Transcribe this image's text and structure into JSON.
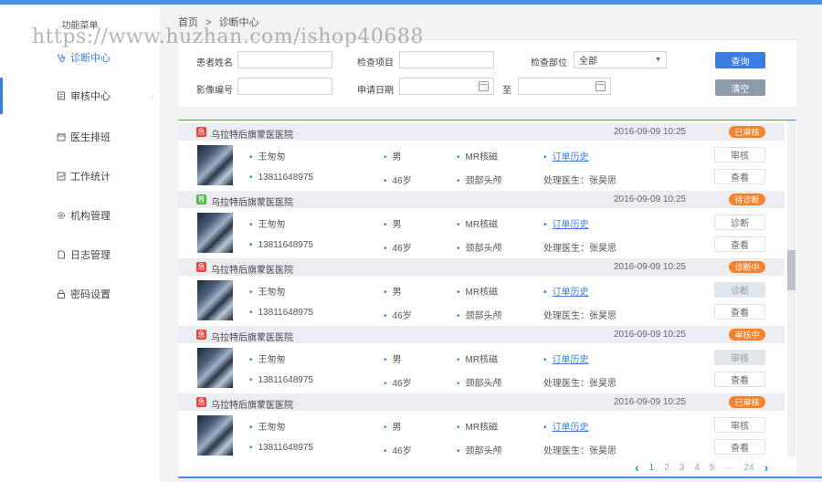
{
  "watermark": "https://www.huzhan.com/ishop40688",
  "breadcrumb": {
    "home": "首页",
    "separator": ">",
    "current": "诊断中心"
  },
  "sidebar": {
    "title": "功能菜单",
    "items": [
      {
        "label": "诊断中心",
        "icon": "stethoscope-icon"
      },
      {
        "label": "审核中心",
        "icon": "document-icon"
      },
      {
        "label": "医生排班",
        "icon": "calendar-icon"
      },
      {
        "label": "工作统计",
        "icon": "chart-icon"
      },
      {
        "label": "机构管理",
        "icon": "gear-icon"
      },
      {
        "label": "日志管理",
        "icon": "log-icon"
      },
      {
        "label": "密码设置",
        "icon": "lock-icon"
      }
    ],
    "chevron": "›"
  },
  "search": {
    "patient_name_label": "患者姓名",
    "exam_item_label": "检查项目",
    "exam_part_label": "检查部位",
    "exam_part_value": "全部",
    "dropdown_arrow": "▼",
    "image_no_label": "影像编号",
    "apply_date_label": "申请日期",
    "to_label": "至",
    "query_button": "查询",
    "clear_button": "清空"
  },
  "records": [
    {
      "hospital": "乌拉特后旗蒙医医院",
      "tag": "急",
      "tag_color": "#e8453c",
      "time": "2016-09-09  10:25",
      "status": "已审核",
      "name": "王匆匆",
      "phone": "13811648975",
      "gender": "男",
      "age": "46岁",
      "modality": "MR核磁",
      "part": "颈部头颅",
      "history": "订单历史",
      "doctor": "处理医生：张昊思",
      "action1": "审核",
      "action1_disabled": false,
      "action2": "查看"
    },
    {
      "hospital": "乌拉特后旗蒙医医院",
      "tag": "普",
      "tag_color": "#4cb848",
      "time": "2016-09-09  10:25",
      "status": "待诊断",
      "name": "王匆匆",
      "phone": "13811648975",
      "gender": "男",
      "age": "46岁",
      "modality": "MR核磁",
      "part": "颈部头颅",
      "history": "订单历史",
      "doctor": "处理医生：张昊思",
      "action1": "诊断",
      "action1_disabled": false,
      "action2": "查看"
    },
    {
      "hospital": "乌拉特后旗蒙医医院",
      "tag": "急",
      "tag_color": "#e8453c",
      "time": "2016-09-09  10:25",
      "status": "诊断中",
      "name": "王匆匆",
      "phone": "13811648975",
      "gender": "男",
      "age": "46岁",
      "modality": "MR核磁",
      "part": "颈部头颅",
      "history": "订单历史",
      "doctor": "处理医生：张昊思",
      "action1": "诊断",
      "action1_disabled": true,
      "action2": "查看"
    },
    {
      "hospital": "乌拉特后旗蒙医医院",
      "tag": "急",
      "tag_color": "#e8453c",
      "time": "2016-09-09  10:25",
      "status": "审核中",
      "name": "王匆匆",
      "phone": "13811648975",
      "gender": "男",
      "age": "46岁",
      "modality": "MR核磁",
      "part": "颈部头颅",
      "history": "订单历史",
      "doctor": "处理医生：张昊思",
      "action1": "审核",
      "action1_disabled": true,
      "action2": "查看"
    },
    {
      "hospital": "乌拉特后旗蒙医医院",
      "tag": "急",
      "tag_color": "#e8453c",
      "time": "2016-09-09  10:25",
      "status": "已审核",
      "name": "王匆匆",
      "phone": "13811648975",
      "gender": "男",
      "age": "46岁",
      "modality": "MR核磁",
      "part": "颈部头颅",
      "history": "订单历史",
      "doctor": "处理医生：张昊思",
      "action1": "审核",
      "action1_disabled": false,
      "action2": "查看"
    }
  ],
  "pagination": {
    "prev": "‹",
    "pages": [
      "1",
      "2",
      "3",
      "4",
      "5"
    ],
    "ellipsis": "···",
    "last": "24",
    "next": "›"
  },
  "colors": {
    "accent": "#3b7de0",
    "status_orange": "#f5822c",
    "urgent_red": "#e8453c",
    "normal_green": "#4cb848"
  }
}
